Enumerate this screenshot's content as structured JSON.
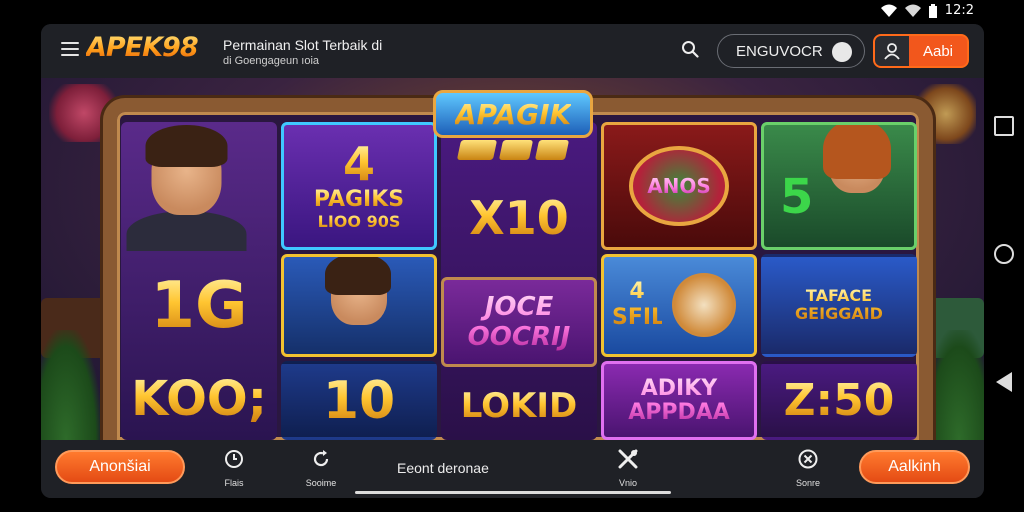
{
  "status_bar": {
    "time": "12:2",
    "icons": [
      "wifi-icon",
      "signal-icon",
      "battery-icon"
    ]
  },
  "header": {
    "logo": "APEK98",
    "tagline": "Permainan Slot Terbaik di",
    "tagline_sub": "di Goengageun ıoia",
    "register_label": "ENGUVOCR",
    "login_label": "Aabi"
  },
  "hero": {
    "banner": "APAGIK",
    "reels": [
      {
        "tiles": [
          "",
          "1G",
          "KOO;"
        ]
      },
      {
        "tiles": [
          "4",
          "PAGIKS",
          "LIOO 90S",
          "",
          "10"
        ]
      },
      {
        "tiles": [
          "X10",
          "JOCE OOCRIJ",
          "LOKID"
        ]
      },
      {
        "tiles": [
          "ANOS",
          "4 SFIL",
          "ADIKY APPDAA"
        ]
      },
      {
        "tiles": [
          "5",
          "TAFACE GEIGGAID",
          "Z:50"
        ]
      }
    ]
  },
  "bottom_bar": {
    "left_button": "Anonšiai",
    "right_button": "Aalkinh",
    "center_label": "Eeont deronae",
    "nav": [
      {
        "label": "Flais",
        "icon": "clock-icon"
      },
      {
        "label": "Sooime",
        "icon": "refresh-icon"
      },
      {
        "label": "Vnio",
        "icon": "tools-icon"
      },
      {
        "label": "Sonre",
        "icon": "close-circle-icon"
      }
    ]
  },
  "colors": {
    "accent": "#f2571c",
    "header_bg": "#1f2126",
    "frame": "#8a5a32",
    "gold": "#ffc531"
  }
}
